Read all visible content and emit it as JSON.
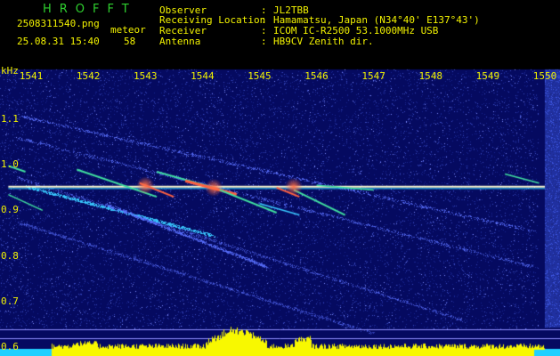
{
  "header": {
    "app_title": "HROFFT",
    "filename": "2508311540.png",
    "mode": "meteor",
    "timestamp": "25.08.31 15:40",
    "count": "58",
    "fields": [
      {
        "label": "Observer",
        "value": "JL2TBB"
      },
      {
        "label": "Receiving Location",
        "value": "Hamamatsu, Japan (N34°40' E137°43')"
      },
      {
        "label": "Receiver",
        "value": "ICOM IC-R2500 53.1000MHz USB"
      },
      {
        "label": "Antenna",
        "value": "HB9CV Zenith dir."
      }
    ],
    "colors": {
      "text": "#f2f200",
      "title": "#2fd02f"
    }
  },
  "spectrogram": {
    "x_unit_label": "kHz",
    "x_ticks": [
      "1541",
      "1542",
      "1543",
      "1544",
      "1545",
      "1546",
      "1547",
      "1548",
      "1549",
      "1550"
    ],
    "y_ticks": [
      "1.1",
      "1.0",
      "0.9",
      "0.8",
      "0.7",
      "0.6"
    ],
    "x_range_seconds": [
      1540.6,
      1550
    ],
    "y_range_khz": [
      0.58,
      1.21
    ],
    "carrier_khz": 0.952,
    "colors": {
      "background": "#050a60",
      "noise": "#3a4ac0",
      "carrier": "#f8f8d0",
      "echo": "#ff6040",
      "echo_trail": "#40e0a0",
      "level_bar": "#f8f800",
      "level_base": "#20d0ff",
      "grid": "#9090ff"
    }
  }
}
